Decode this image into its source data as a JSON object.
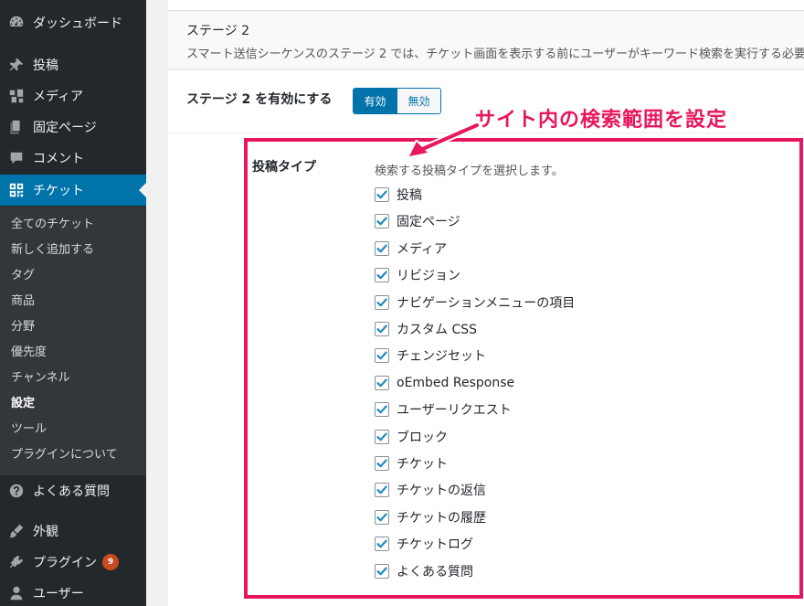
{
  "sidebar": {
    "menu": [
      {
        "label": "ダッシュボード",
        "icon": "dashboard-icon"
      },
      {
        "label": "投稿",
        "icon": "pin-icon"
      },
      {
        "label": "メディア",
        "icon": "media-icon"
      },
      {
        "label": "固定ページ",
        "icon": "page-icon"
      },
      {
        "label": "コメント",
        "icon": "comment-icon"
      },
      {
        "label": "チケット",
        "icon": "ticket-grid-icon"
      },
      {
        "label": "よくある質問",
        "icon": "question-icon"
      },
      {
        "label": "外観",
        "icon": "paintbrush-icon"
      },
      {
        "label": "プラグイン",
        "icon": "plugin-icon",
        "badge": "9"
      },
      {
        "label": "ユーザー",
        "icon": "user-icon"
      }
    ],
    "submenu": [
      "全てのチケット",
      "新しく追加する",
      "タグ",
      "商品",
      "分野",
      "優先度",
      "チャンネル",
      "設定",
      "ツール",
      "プラグインについて"
    ]
  },
  "main": {
    "stage_title": "ステージ 2",
    "stage_desc": "スマート送信シーケンスのステージ 2 では、チケット画面を表示する前にユーザーがキーワード検索を実行する必要",
    "enable_label": "ステージ 2 を有効にする",
    "toggle_on": "有効",
    "toggle_off": "無効",
    "annotation": "サイト内の検索範囲を設定",
    "post_types_label": "投稿タイプ",
    "post_types_desc": "検索する投稿タイプを選択します。",
    "post_types": [
      "投稿",
      "固定ページ",
      "メディア",
      "リビジョン",
      "ナビゲーションメニューの項目",
      "カスタム CSS",
      "チェンジセット",
      "oEmbed Response",
      "ユーザーリクエスト",
      "ブロック",
      "チケット",
      "チケットの返信",
      "チケットの履歴",
      "チケットログ",
      "よくある質問"
    ]
  },
  "colors": {
    "active": "#0073aa",
    "annotation": "#e8175d",
    "sidebar": "#23282d",
    "badge": "#ca4a1f"
  }
}
